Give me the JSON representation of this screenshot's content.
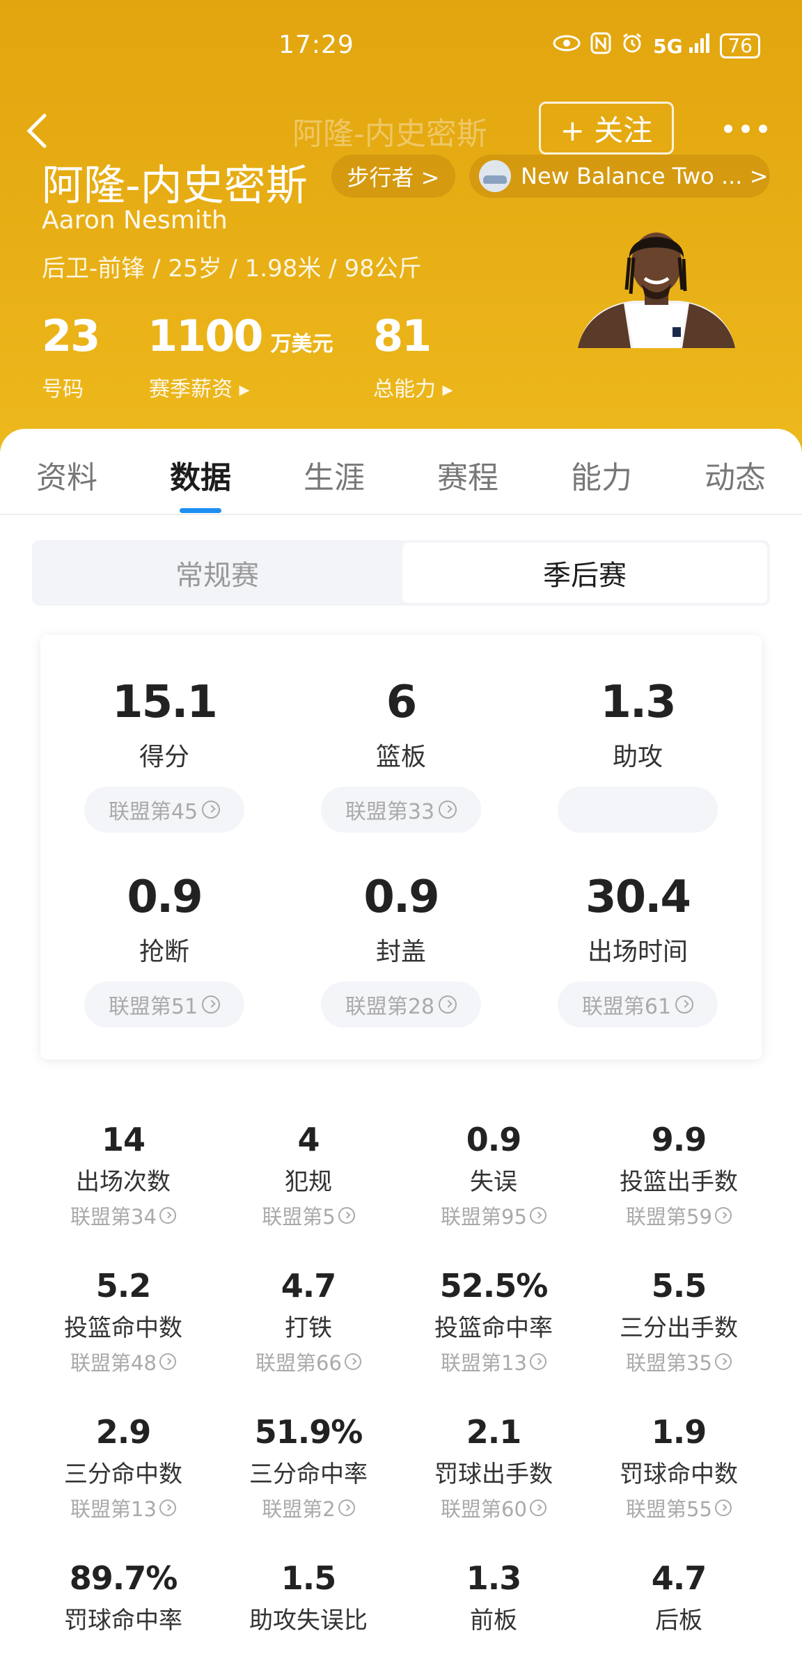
{
  "status_bar": {
    "time": "17:29",
    "battery": "76",
    "signal": "5G"
  },
  "nav": {
    "faded_title": "阿隆-内史密斯",
    "follow_label": "+ 关注"
  },
  "player": {
    "name_cn": "阿隆-内史密斯",
    "name_en": "Aaron Nesmith",
    "meta": "后卫-前锋 / 25岁 / 1.98米 / 98公斤",
    "tag_walker": "步行者 >",
    "tag_shoe": "New Balance Two ...  >"
  },
  "header_stats": [
    {
      "value": "23",
      "unit": "",
      "label": "号码"
    },
    {
      "value": "1100",
      "unit": "万美元",
      "label": "赛季薪资 ▸"
    },
    {
      "value": "81",
      "unit": "",
      "label": "总能力 ▸"
    }
  ],
  "tabs": [
    "资料",
    "数据",
    "生涯",
    "赛程",
    "能力",
    "动态"
  ],
  "active_tab": "数据",
  "segment": {
    "regular": "常规赛",
    "playoff": "季后赛",
    "selected": "季后赛"
  },
  "main_stats": [
    {
      "value": "15.1",
      "label": "得分",
      "rank": "联盟第45"
    },
    {
      "value": "6",
      "label": "篮板",
      "rank": "联盟第33"
    },
    {
      "value": "1.3",
      "label": "助攻",
      "rank": ""
    },
    {
      "value": "0.9",
      "label": "抢断",
      "rank": "联盟第51"
    },
    {
      "value": "0.9",
      "label": "封盖",
      "rank": "联盟第28"
    },
    {
      "value": "30.4",
      "label": "出场时间",
      "rank": "联盟第61"
    }
  ],
  "grid_stats": [
    {
      "value": "14",
      "label": "出场次数",
      "rank": "联盟第34"
    },
    {
      "value": "4",
      "label": "犯规",
      "rank": "联盟第5"
    },
    {
      "value": "0.9",
      "label": "失误",
      "rank": "联盟第95"
    },
    {
      "value": "9.9",
      "label": "投篮出手数",
      "rank": "联盟第59"
    },
    {
      "value": "5.2",
      "label": "投篮命中数",
      "rank": "联盟第48"
    },
    {
      "value": "4.7",
      "label": "打铁",
      "rank": "联盟第66"
    },
    {
      "value": "52.5%",
      "label": "投篮命中率",
      "rank": "联盟第13"
    },
    {
      "value": "5.5",
      "label": "三分出手数",
      "rank": "联盟第35"
    },
    {
      "value": "2.9",
      "label": "三分命中数",
      "rank": "联盟第13"
    },
    {
      "value": "51.9%",
      "label": "三分命中率",
      "rank": "联盟第2"
    },
    {
      "value": "2.1",
      "label": "罚球出手数",
      "rank": "联盟第60"
    },
    {
      "value": "1.9",
      "label": "罚球命中数",
      "rank": "联盟第55"
    },
    {
      "value": "89.7%",
      "label": "罚球命中率",
      "rank": ""
    },
    {
      "value": "1.5",
      "label": "助攻失误比",
      "rank": ""
    },
    {
      "value": "1.3",
      "label": "前板",
      "rank": ""
    },
    {
      "value": "4.7",
      "label": "后板",
      "rank": ""
    }
  ]
}
